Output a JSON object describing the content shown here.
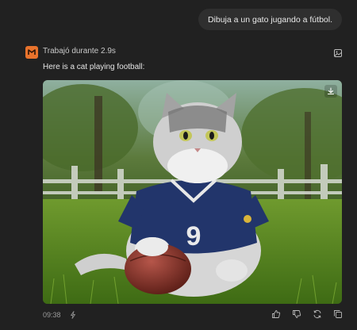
{
  "conversation": {
    "user_message": "Dibuja a un gato jugando a fútbol.",
    "assistant": {
      "thought_label": "Trabajó durante 2.9s",
      "reply_text": "Here is a cat playing football:",
      "image": {
        "jersey_number": "9"
      },
      "footer": {
        "time": "09:38"
      }
    }
  },
  "icons": {
    "avatar": "brand-logo-icon",
    "image_toggle": "image-icon",
    "download": "download-icon",
    "bolt": "lightning-icon",
    "like": "thumbs-up-icon",
    "dislike": "thumbs-down-icon",
    "regenerate": "refresh-icon",
    "copy": "copy-icon"
  },
  "colors": {
    "background": "#212121",
    "bubble": "#2f2f2f",
    "avatar": "#e8732c"
  }
}
